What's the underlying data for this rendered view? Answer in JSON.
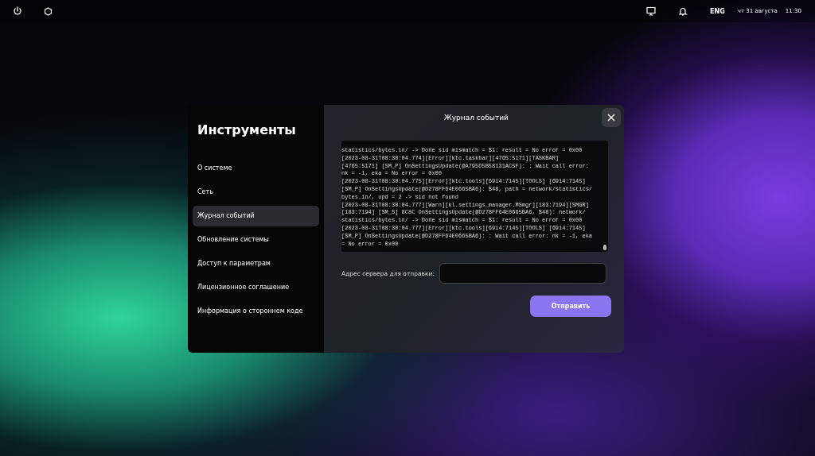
{
  "top_bar": {
    "language": "ENG",
    "date": "чт 31 августа",
    "time": "11:30"
  },
  "sidebar": {
    "title": "Инструменты",
    "items": [
      {
        "label": "О системе",
        "selected": false
      },
      {
        "label": "Сеть",
        "selected": false
      },
      {
        "label": "Журнал событий",
        "selected": true
      },
      {
        "label": "Обновление системы",
        "selected": false
      },
      {
        "label": "Доступ к параметрам",
        "selected": false
      },
      {
        "label": "Лицензионное соглашение",
        "selected": false
      },
      {
        "label": "Информация о стороннем коде",
        "selected": false
      }
    ]
  },
  "dialog": {
    "title": "Журнал событий",
    "log_lines": [
      "statistics/bytes.in/ -> Done sid mismatch = $1: result = No error = 0x00",
      "[2023-08-31T08:30:04.774][Error][ktc.taskbar][4765:5171][TASKBAR]",
      "[4765:5171] [SM_P] OnSettingsUpdate(@A795D5B58131AC5F): : Wait call error:",
      "nk = -1, eka = No error = 0x00",
      "[2023-08-31T08:30:04.775][Error][ktc.tools][6914:7145][TOOLS] [6914:7145]",
      "[SM_P] OnSettingsUpdate(@D278FF64E0665BA6): $48, path = network/statistics/",
      "bytes.in/, upd = 2 -> sid not found",
      "[2023-08-31T08:30:04.777][Warn][kl.settings_manager.MSmgr][183:7194][SMGR]",
      "[183:7194] [SM_S] 8C8C OnSettingsUpdate(@D278FF64E0665BA6, $48): network/",
      "statistics/bytes.in/ -> Done sid mismatch = $1: result = No error = 0x00",
      "[2023-08-31T08:30:04.777][Error][ktc.tools][6914:7145][TOOLS] [6914:7145]",
      "[SM_P] OnSettingsUpdate(@D278FF64E0665BA6): : Wait call error: nk = -1, eka",
      "= No error = 0x00"
    ],
    "server_label": "Адрес сервера для отправки:",
    "send_button": "Отправить"
  }
}
